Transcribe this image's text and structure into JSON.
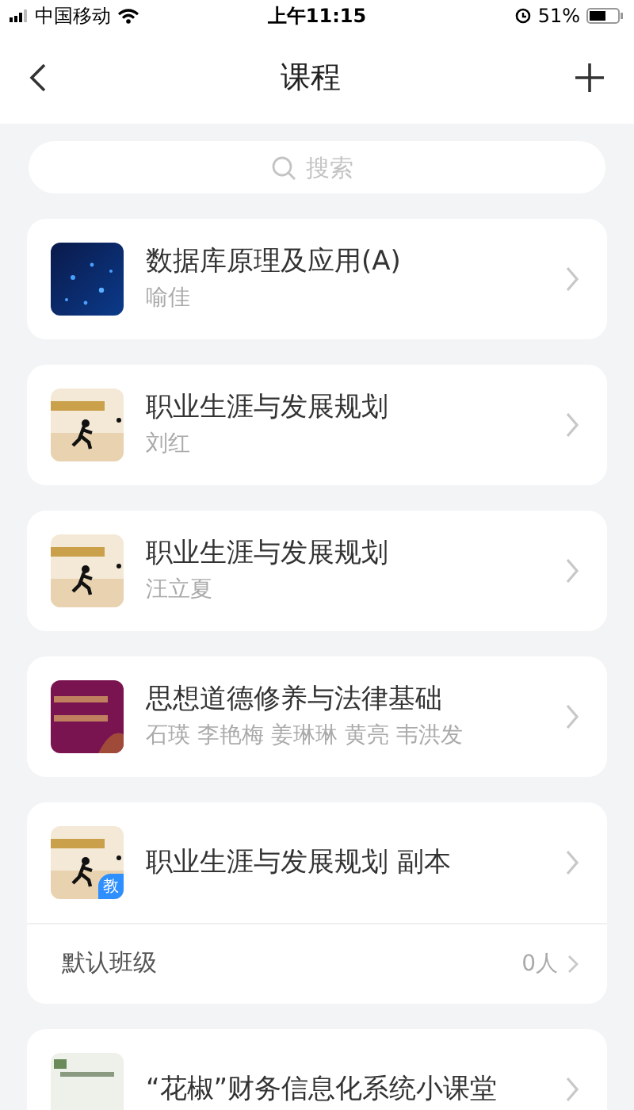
{
  "status_bar": {
    "carrier": "中国移动",
    "time": "上午11:15",
    "battery": "51%"
  },
  "nav": {
    "title": "课程"
  },
  "search": {
    "placeholder": "搜索"
  },
  "courses": [
    {
      "title": "数据库原理及应用(A)",
      "teachers": "喻佳"
    },
    {
      "title": "职业生涯与发展规划",
      "teachers": "刘红"
    },
    {
      "title": "职业生涯与发展规划",
      "teachers": "汪立夏"
    },
    {
      "title": "思想道德修养与法律基础",
      "teachers": "石瑛 李艳梅 姜琳琳 黄亮 韦洪发"
    },
    {
      "title": "职业生涯与发展规划 副本",
      "badge": "教",
      "classes": [
        {
          "name": "默认班级",
          "count": "0人"
        }
      ]
    },
    {
      "title": "“花椒”财务信息化系统小课堂"
    }
  ]
}
